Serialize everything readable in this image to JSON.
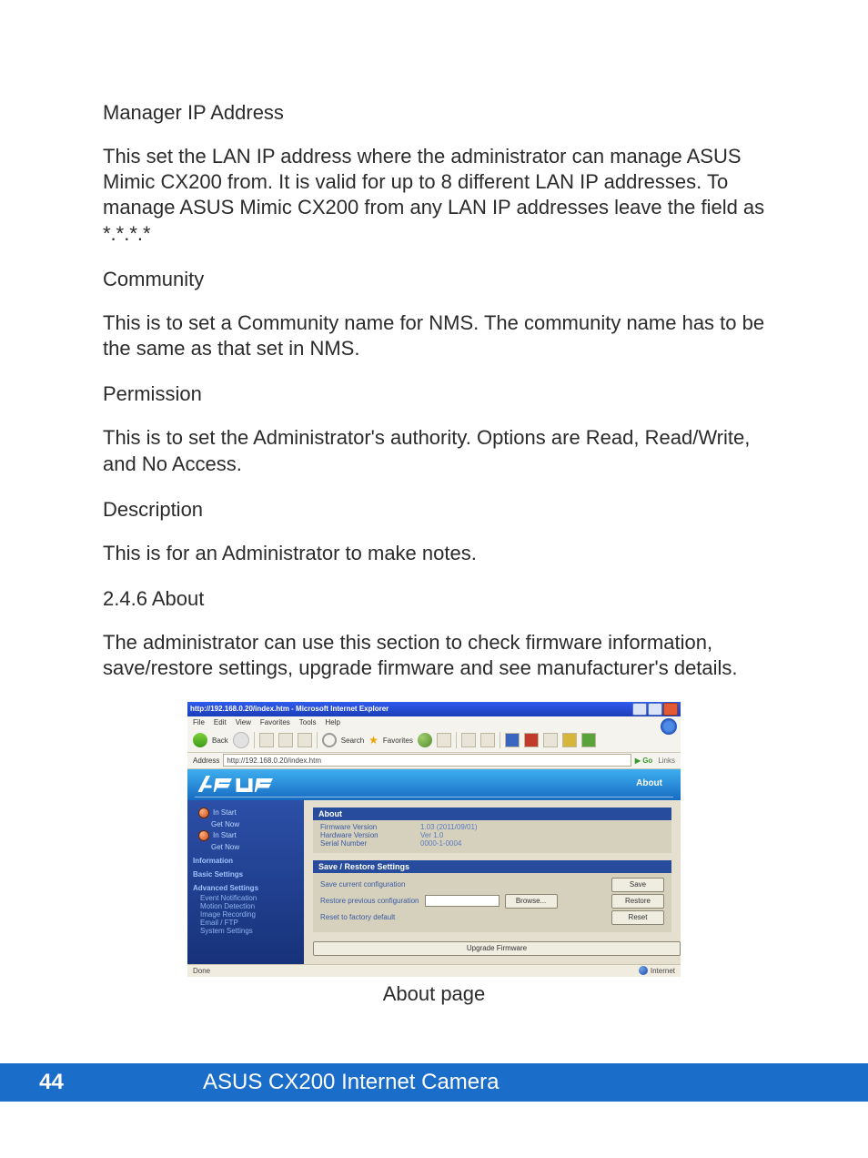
{
  "sections": {
    "manager_ip": {
      "title": "Manager IP Address",
      "body": "This set the LAN IP address where the administrator can manage ASUS Mimic CX200 from.  It is valid for up to 8 different LAN IP addresses.  To manage ASUS Mimic CX200 from any LAN IP addresses leave the field as *.*.*.*"
    },
    "community": {
      "title": "Community",
      "body": "This is to set a Community name for NMS. The community name has to be the same as that set in NMS."
    },
    "permission": {
      "title": "Permission",
      "body": "This is to set the Administrator's authority.  Options are Read, Read/Write, and No Access."
    },
    "description": {
      "title": "Description",
      "body": "This is for an Administrator to make notes."
    },
    "about_head": {
      "title": "2.4.6 About",
      "body": "The administrator can use this section to check firmware information, save/restore settings, upgrade firmware and see manufacturer's details."
    }
  },
  "screenshot": {
    "window_title": "http://192.168.0.20/index.htm - Microsoft Internet Explorer",
    "menu": [
      "File",
      "Edit",
      "View",
      "Favorites",
      "Tools",
      "Help"
    ],
    "toolbar": {
      "back": "Back",
      "search": "Search",
      "favorites": "Favorites"
    },
    "address_label": "Address",
    "address_url": "http://192.168.0.20/index.htm",
    "go_label": "Go",
    "links_label": "Links",
    "header_right": "About",
    "sidebar": {
      "top_items": [
        "In Start",
        "Get Now",
        "In Start",
        "Get Now"
      ],
      "titles": [
        "Information",
        "Basic Settings",
        "Advanced Settings"
      ],
      "adv_items": [
        "Event Notification",
        "Motion Detection",
        "Image Recording",
        "Email / FTP",
        "System Settings"
      ]
    },
    "about_panel": {
      "title": "About",
      "rows": [
        {
          "k": "Firmware Version",
          "v": "1.03 (2011/09/01)"
        },
        {
          "k": "Hardware Version",
          "v": "Ver 1.0"
        },
        {
          "k": "Serial Number",
          "v": "0000-1-0004"
        }
      ]
    },
    "save_panel": {
      "title": "Save / Restore Settings",
      "rows": [
        {
          "label": "Save current configuration",
          "btn": "Save"
        },
        {
          "label": "Restore previous configuration",
          "browse": "Browse...",
          "btn": "Restore"
        },
        {
          "label": "Reset to factory default",
          "btn": "Reset"
        }
      ]
    },
    "upgrade_btn": "Upgrade Firmware",
    "status_left": "Done",
    "status_right": "Internet"
  },
  "caption": "About page",
  "footer": {
    "page": "44",
    "title": "ASUS CX200 Internet Camera"
  }
}
